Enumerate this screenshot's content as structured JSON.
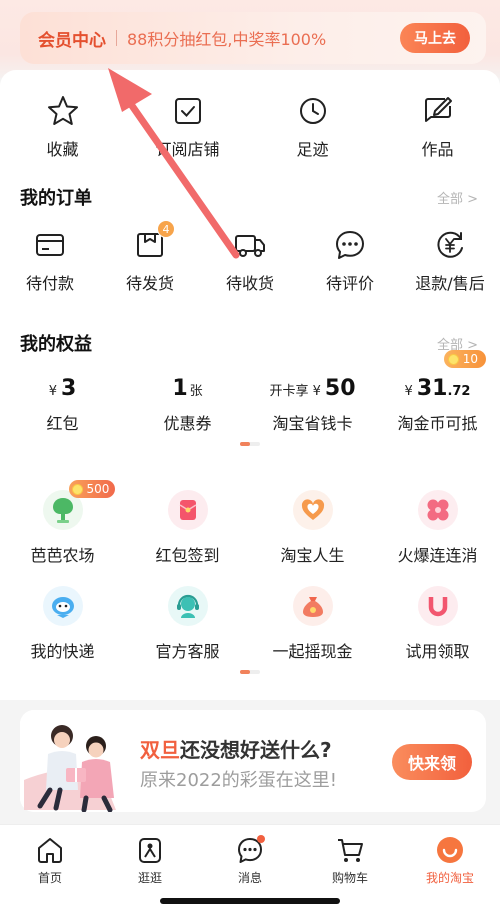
{
  "member": {
    "title": "会员中心",
    "promo": "88积分抽红包,中奖率100%",
    "go_button": "马上去"
  },
  "shortcuts": [
    {
      "label": "收藏",
      "icon": "star-icon"
    },
    {
      "label": "订阅店铺",
      "icon": "subscribe-check-icon"
    },
    {
      "label": "足迹",
      "icon": "clock-icon"
    },
    {
      "label": "作品",
      "icon": "edit-note-icon"
    }
  ],
  "orders": {
    "title": "我的订单",
    "see_all": "全部 >",
    "items": [
      {
        "label": "待付款",
        "icon": "card-icon"
      },
      {
        "label": "待发货",
        "icon": "package-icon",
        "badge": "4"
      },
      {
        "label": "待收货",
        "icon": "truck-icon"
      },
      {
        "label": "待评价",
        "icon": "chat-dots-icon"
      },
      {
        "label": "退款/售后",
        "icon": "refund-icon"
      }
    ]
  },
  "rights": {
    "title": "我的权益",
    "see_all": "全部 >",
    "items": [
      {
        "prefix": "¥",
        "value": "3",
        "suffix": "",
        "label": "红包"
      },
      {
        "prefix": "",
        "value": "1",
        "suffix": "张",
        "label": "优惠券"
      },
      {
        "prefix": "开卡享 ¥",
        "value": "50",
        "suffix": "",
        "label": "淘宝省钱卡"
      },
      {
        "prefix": "¥",
        "value": "31",
        "suffix": ".72",
        "label": "淘金币可抵",
        "badge": "10"
      }
    ]
  },
  "services": [
    {
      "label": "芭芭农场",
      "icon": "tree-icon",
      "badge": "500"
    },
    {
      "label": "红包签到",
      "icon": "red-envelope-icon"
    },
    {
      "label": "淘宝人生",
      "icon": "heart-badge-icon"
    },
    {
      "label": "火爆连连消",
      "icon": "clover-icon"
    },
    {
      "label": "我的快递",
      "icon": "courier-mascot-icon"
    },
    {
      "label": "官方客服",
      "icon": "headset-icon"
    },
    {
      "label": "一起摇现金",
      "icon": "money-bag-icon"
    },
    {
      "label": "试用领取",
      "icon": "magnet-icon"
    }
  ],
  "promo": {
    "title_highlight": "双旦",
    "title_rest": "还没想好送什么?",
    "subtitle": "原来2022的彩蛋在这里!",
    "button": "快来领"
  },
  "tabs": [
    {
      "label": "首页",
      "icon": "home-icon"
    },
    {
      "label": "逛逛",
      "icon": "stroll-icon"
    },
    {
      "label": "消息",
      "icon": "message-icon"
    },
    {
      "label": "购物车",
      "icon": "cart-icon"
    },
    {
      "label": "我的淘宝",
      "icon": "my-taobao-icon",
      "active": true
    }
  ],
  "colors": {
    "accent": "#f1603f",
    "badge_orange": "#f7a44b",
    "annotation_arrow": "#f16a6a"
  }
}
